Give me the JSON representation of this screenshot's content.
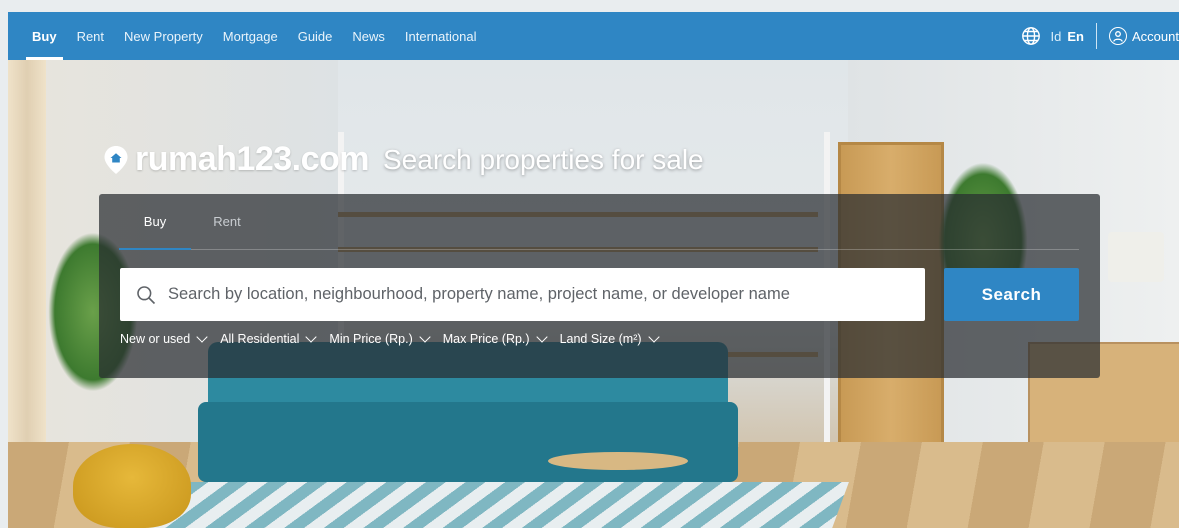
{
  "nav": {
    "items": [
      {
        "label": "Buy",
        "active": true
      },
      {
        "label": "Rent",
        "active": false
      },
      {
        "label": "New Property",
        "active": false
      },
      {
        "label": "Mortgage",
        "active": false
      },
      {
        "label": "Guide",
        "active": false
      },
      {
        "label": "News",
        "active": false
      },
      {
        "label": "International",
        "active": false
      }
    ],
    "lang_id": "Id",
    "lang_en": "En",
    "account_label": "Account",
    "globe_icon": "globe-icon",
    "account_icon": "user-circle-icon"
  },
  "brand": {
    "logo_text": "rumah123.com",
    "tagline": "Search properties for sale",
    "logo_icon": "location-pin-home-icon"
  },
  "search_panel": {
    "tabs": [
      {
        "label": "Buy",
        "active": true
      },
      {
        "label": "Rent",
        "active": false
      }
    ],
    "placeholder": "Search by location, neighbourhood, property name, project name, or developer name",
    "search_label": "Search",
    "filters": [
      {
        "label": "New or used"
      },
      {
        "label": "All Residential"
      },
      {
        "label": "Min Price (Rp.)"
      },
      {
        "label": "Max Price (Rp.)"
      },
      {
        "label": "Land Size (m²)"
      }
    ]
  },
  "colors": {
    "brand_blue": "#2f86c4",
    "panel_bg": "rgba(40,44,48,0.72)"
  }
}
